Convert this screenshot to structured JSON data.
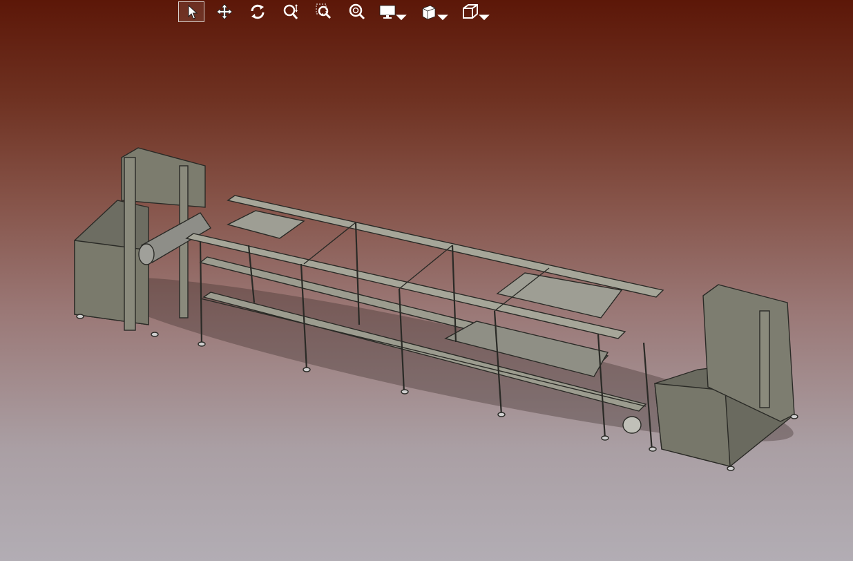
{
  "window": {
    "type": "3d-cad-viewport"
  },
  "toolbar": {
    "tools": [
      {
        "id": "select",
        "icon": "select-arrow-icon",
        "active": true
      },
      {
        "id": "pan",
        "icon": "pan-move-icon"
      },
      {
        "id": "rotate",
        "icon": "rotate-icon"
      },
      {
        "id": "zoom-in-out",
        "icon": "zoom-in-out-icon"
      },
      {
        "id": "zoom-area",
        "icon": "zoom-area-icon"
      },
      {
        "id": "fit-all",
        "icon": "fit-all-icon"
      },
      {
        "id": "view-mode",
        "icon": "view-mode-monitor-icon",
        "dropdown": true
      },
      {
        "id": "render-style",
        "icon": "render-style-icon",
        "dropdown": true
      },
      {
        "id": "view-orientation",
        "icon": "isometric-view-cube-icon",
        "dropdown": true
      }
    ]
  },
  "scene": {
    "model": "conveyor-assembly-machine",
    "background_top": "#5c1708",
    "background_bottom": "#b2adb4",
    "model_color": "#8a8a7c"
  }
}
